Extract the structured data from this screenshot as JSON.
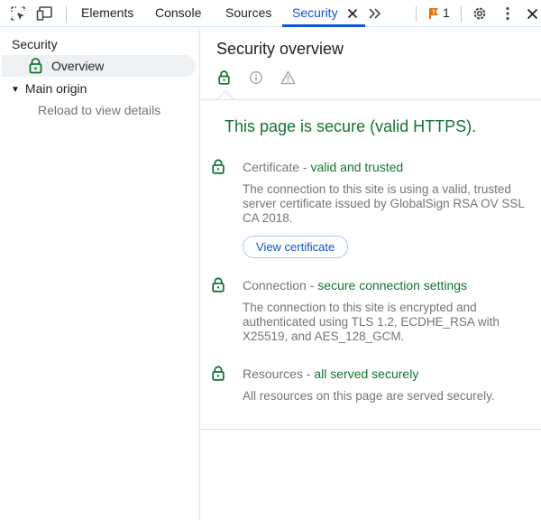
{
  "toolbar": {
    "tabs": [
      "Elements",
      "Console",
      "Sources",
      "Security"
    ],
    "active_tab": "Security",
    "issue_count": "1"
  },
  "sidebar": {
    "title": "Security",
    "overview_label": "Overview",
    "main_origin_label": "Main origin",
    "reload_text": "Reload to view details"
  },
  "main": {
    "title": "Security overview",
    "headline": "This page is secure (valid HTTPS).",
    "certificate": {
      "label": "Certificate",
      "separator": " - ",
      "status": "valid and trusted",
      "description": "The connection to this site is using a valid, trusted server certificate issued by GlobalSign RSA OV SSL CA 2018.",
      "button_label": "View certificate"
    },
    "connection": {
      "label": "Connection",
      "separator": " - ",
      "status": "secure connection settings",
      "description": "The connection to this site is encrypted and authenticated using TLS 1.2, ECDHE_RSA with X25519, and AES_128_GCM."
    },
    "resources": {
      "label": "Resources",
      "separator": " - ",
      "status": "all served securely",
      "description": "All resources on this page are served securely."
    }
  },
  "colors": {
    "accent": "#0b57d0",
    "secure_green": "#137333",
    "muted_text": "#757575",
    "issue_orange": "#e8710a"
  },
  "icons": {
    "inspect": "inspect-element-icon",
    "device": "device-toolbar-icon",
    "close_tab": "close-icon",
    "more_tabs": "chevron-double-right-icon",
    "issues": "issue-flag-icon",
    "settings": "gear-icon",
    "menu": "kebab-menu-icon",
    "close_devtools": "close-icon",
    "lock": "lock-icon",
    "info": "info-icon",
    "warning": "warning-icon",
    "expand": "triangle-down-icon"
  }
}
